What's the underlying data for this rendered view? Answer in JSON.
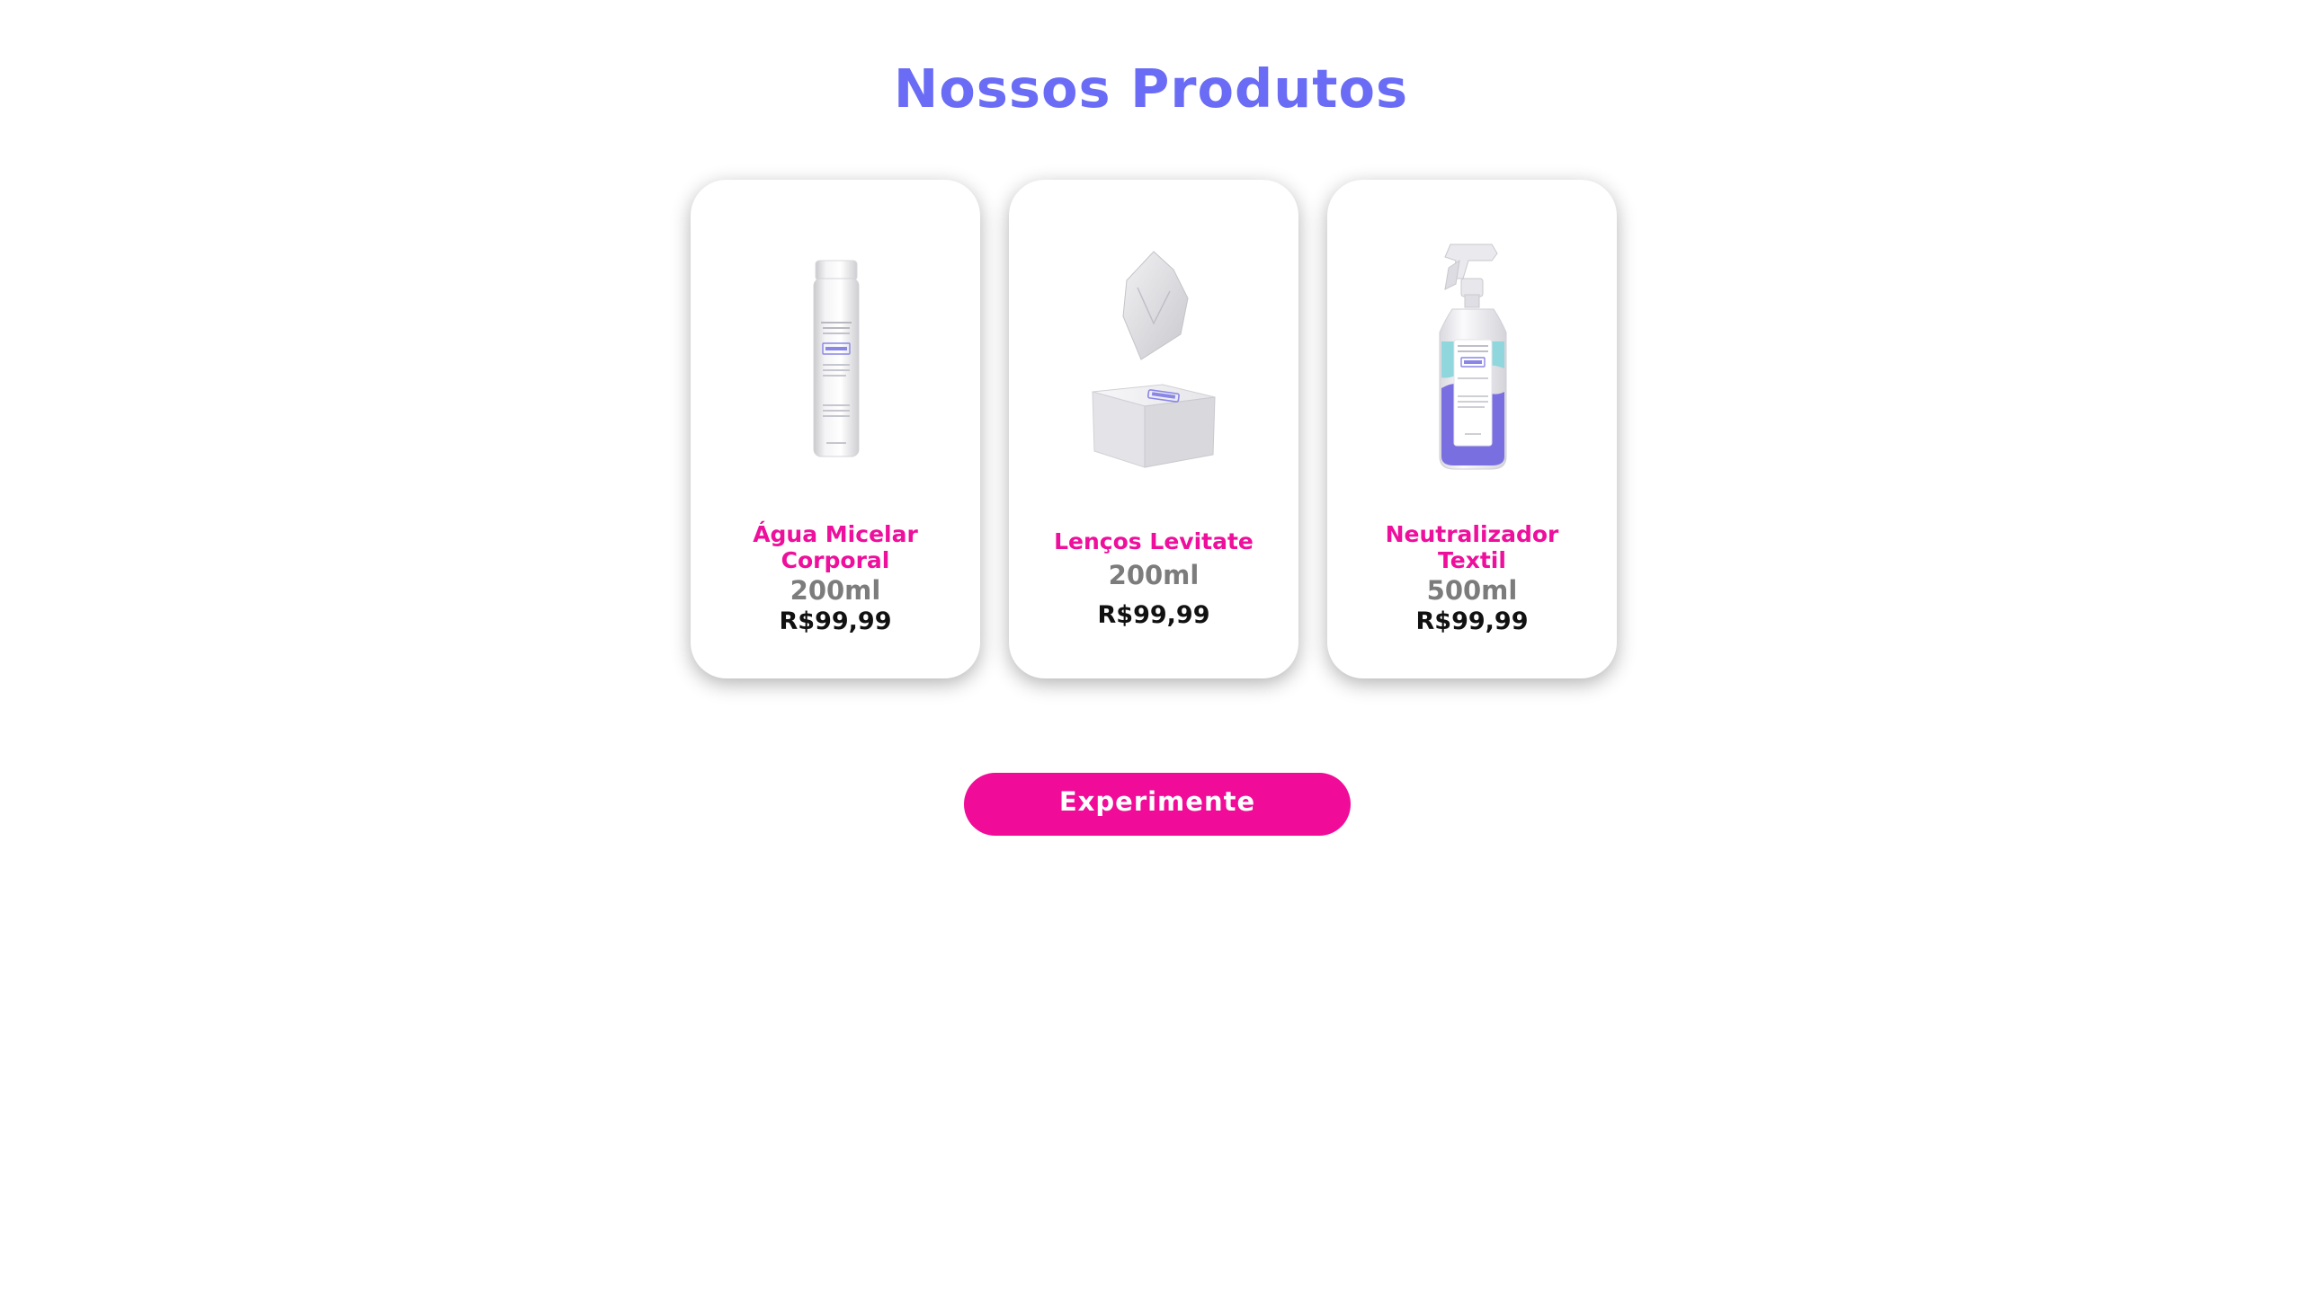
{
  "section": {
    "title": "Nossos Produtos"
  },
  "products": [
    {
      "name": "Água Micelar Corporal",
      "size": "200ml",
      "price": "R$99,99",
      "image_icon": "micellar-water-bottle"
    },
    {
      "name": "Lenços Levitate",
      "size": "200ml",
      "price": "R$99,99",
      "image_icon": "wipes-box"
    },
    {
      "name": "Neutralizador Textil",
      "size": "500ml",
      "price": "R$99,99",
      "image_icon": "spray-bottle"
    }
  ],
  "cta": {
    "label": "Experimente"
  },
  "colors": {
    "title": "#6a6cf6",
    "product_name": "#ee0f9c",
    "size": "#7c7c7c",
    "price": "#111111",
    "cta_background": "#f00c98",
    "brand_purple": "#7a6fe0",
    "brand_teal": "#8fd7dd"
  }
}
